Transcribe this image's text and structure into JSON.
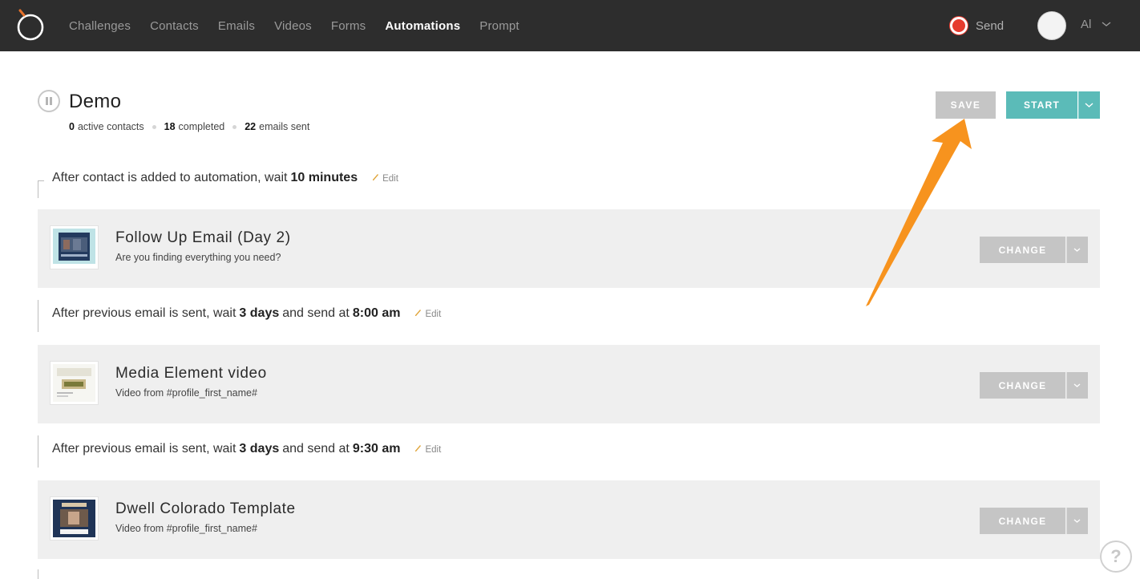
{
  "nav": {
    "items": [
      "Challenges",
      "Contacts",
      "Emails",
      "Videos",
      "Forms",
      "Automations",
      "Prompt"
    ],
    "active": "Automations",
    "send_label": "Send",
    "user_label": "Al"
  },
  "automation": {
    "title": "Demo",
    "stats": {
      "active_value": "0",
      "active_label": "active contacts",
      "completed_value": "18",
      "completed_label": "completed",
      "sent_value": "22",
      "sent_label": "emails sent"
    },
    "save_label": "SAVE",
    "start_label": "START"
  },
  "steps": [
    {
      "wait": {
        "pre": "After contact is added to automation, wait",
        "duration": "10 minutes",
        "mid": "",
        "time": ""
      },
      "edit_label": "Edit",
      "title": "Follow Up Email (Day 2)",
      "subtitle": "Are you finding everything you need?",
      "change_label": "CHANGE"
    },
    {
      "wait": {
        "pre": "After previous email is sent, wait",
        "duration": "3 days",
        "mid": "and send at",
        "time": "8:00 am"
      },
      "edit_label": "Edit",
      "title": "Media Element video",
      "subtitle": "Video from #profile_first_name#",
      "change_label": "CHANGE"
    },
    {
      "wait": {
        "pre": "After previous email is sent, wait",
        "duration": "3 days",
        "mid": "and send at",
        "time": "9:30 am"
      },
      "edit_label": "Edit",
      "title": "Dwell Colorado Template",
      "subtitle": "Video from #profile_first_name#",
      "change_label": "CHANGE"
    }
  ],
  "help_label": "?",
  "colors": {
    "topbar": "#2d2d2d",
    "accent_teal": "#5bbbb8",
    "button_gray": "#c5c5c5",
    "record_red": "#e63b2e",
    "arrow_orange": "#f7931e"
  }
}
